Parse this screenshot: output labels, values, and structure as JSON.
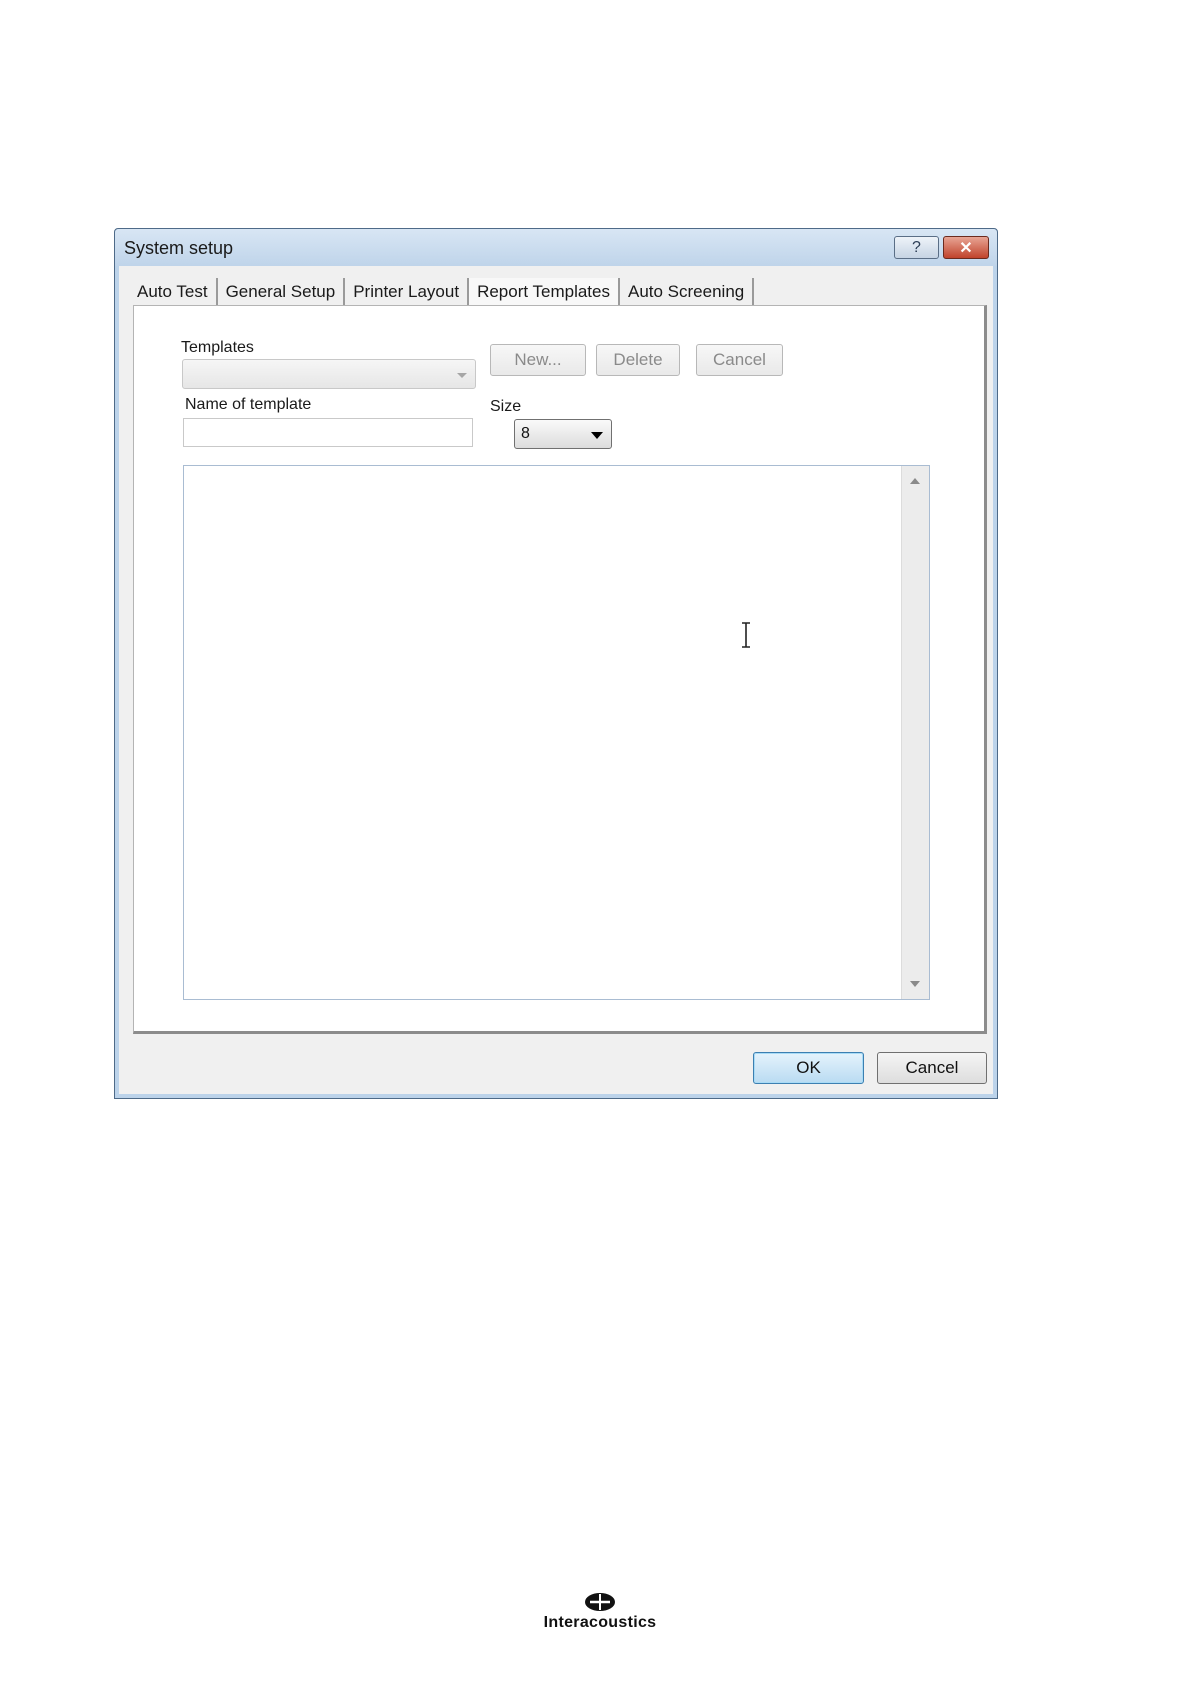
{
  "dialog": {
    "title": "System setup",
    "help_symbol": "?",
    "close_symbol": "✕",
    "tabs": [
      {
        "label": "Auto Test",
        "active": false
      },
      {
        "label": "General Setup",
        "active": false
      },
      {
        "label": "Printer Layout",
        "active": false
      },
      {
        "label": "Report Templates",
        "active": true
      },
      {
        "label": "Auto Screening",
        "active": false
      }
    ],
    "report_templates": {
      "templates_label": "Templates",
      "templates_value": "",
      "name_label": "Name of template",
      "name_value": "",
      "size_label": "Size",
      "size_value": "8",
      "new_button": "New...",
      "delete_button": "Delete",
      "cancel_button": "Cancel",
      "editor_text": ""
    },
    "ok_button": "OK",
    "cancel_button": "Cancel"
  },
  "footer": {
    "logo_text": "Interacoustics"
  }
}
